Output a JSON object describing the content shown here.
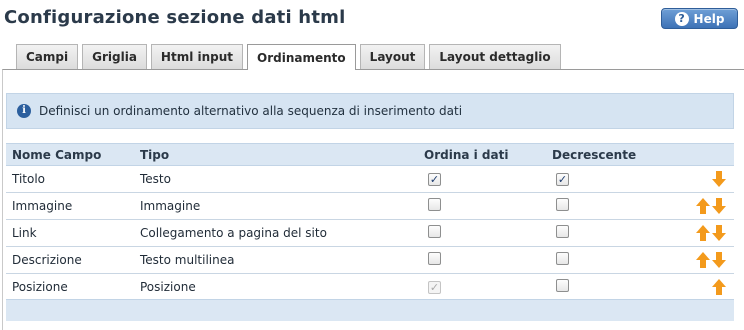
{
  "title": "Configurazione sezione dati html",
  "help_label": "Help",
  "tabs": [
    {
      "label": "Campi"
    },
    {
      "label": "Griglia"
    },
    {
      "label": "Html input"
    },
    {
      "label": "Ordinamento",
      "active": true
    },
    {
      "label": "Layout"
    },
    {
      "label": "Layout dettaglio"
    }
  ],
  "info_message": "Definisci un ordinamento alternativo alla sequenza di inserimento dati",
  "grid": {
    "headers": [
      "Nome Campo",
      "Tipo",
      "Ordina i dati",
      "Decrescente"
    ],
    "rows": [
      {
        "name": "Titolo",
        "type": "Testo",
        "sort": "checked",
        "desc": "checked",
        "move": [
          "down"
        ]
      },
      {
        "name": "Immagine",
        "type": "Immagine",
        "sort": "unchecked",
        "desc": "unchecked",
        "move": [
          "up",
          "down"
        ]
      },
      {
        "name": "Link",
        "type": "Collegamento a pagina del sito",
        "sort": "unchecked",
        "desc": "unchecked",
        "move": [
          "up",
          "down"
        ]
      },
      {
        "name": "Descrizione",
        "type": "Testo multilinea",
        "sort": "unchecked",
        "desc": "unchecked",
        "move": [
          "up",
          "down"
        ]
      },
      {
        "name": "Posizione",
        "type": "Posizione",
        "sort": "checked-disabled",
        "desc": "unchecked",
        "move": [
          "up"
        ]
      }
    ]
  },
  "colors": {
    "accent": "#3d72b6",
    "arrow": "#f39a1c",
    "header_bg": "#dbe7f3",
    "info_bg": "#d6e4f2"
  }
}
